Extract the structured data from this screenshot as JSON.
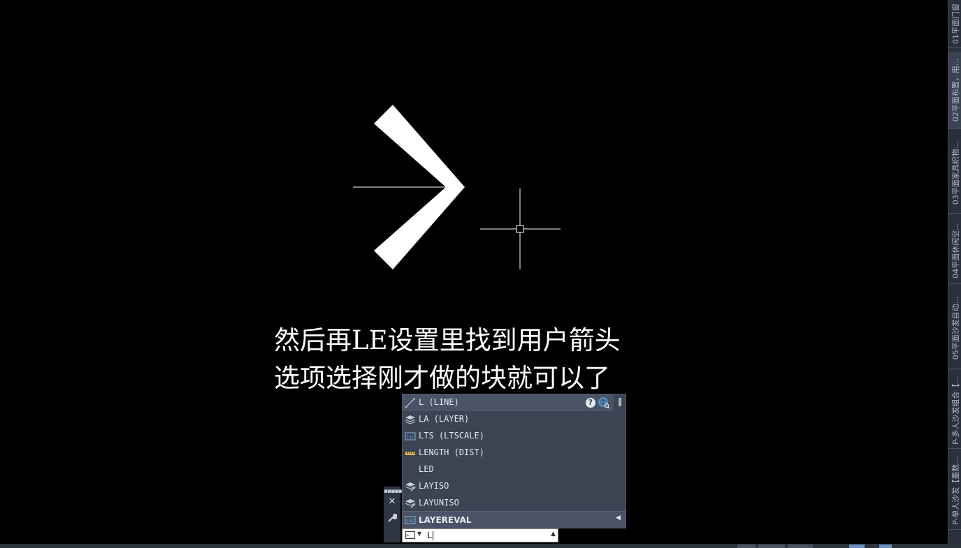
{
  "caption": {
    "line1": "然后再LE设置里找到用户箭头",
    "line2": "选项选择刚才做的块就可以了"
  },
  "tabs": [
    {
      "label": "01平面门窗",
      "active": false
    },
    {
      "label": "02平面布置，用...",
      "active": true
    },
    {
      "label": "03平面家具织物...",
      "active": false
    },
    {
      "label": "04平面休闲空...",
      "active": false
    },
    {
      "label": "05平面沙发自动...",
      "active": false
    },
    {
      "label": "P-多人沙发组合【...",
      "active": false
    },
    {
      "label": "P-单人沙发【墨数...",
      "active": false
    }
  ],
  "autocomplete": {
    "items": [
      {
        "label": "L (LINE)",
        "icon": "line-icon"
      },
      {
        "label": "LA (LAYER)",
        "icon": "layer-properties-icon"
      },
      {
        "label": "LTS (LTSCALE)",
        "icon": "system-variable-icon"
      },
      {
        "label": "LENGTH (DIST)",
        "icon": "measure-ruler-icon"
      },
      {
        "label": "LED",
        "icon": ""
      },
      {
        "label": "LAYISO",
        "icon": "layer-isolate-icon"
      },
      {
        "label": "LAYUNISO",
        "icon": "layer-unisolate-icon"
      },
      {
        "label": "LAYEREVAL",
        "icon": "system-variable-icon"
      }
    ],
    "help_glyph": "?"
  },
  "command": {
    "value": "L",
    "prompt_icon": ">_"
  },
  "colors": {
    "canvas": "#000000",
    "panel": "#3b4453",
    "drawing": "#ffffff"
  }
}
